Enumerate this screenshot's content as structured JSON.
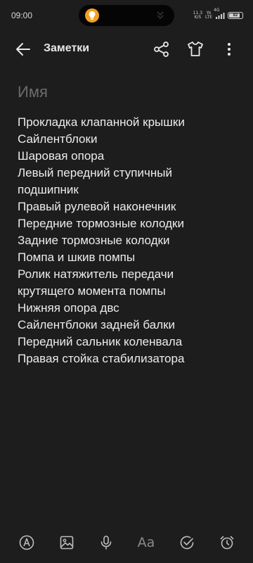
{
  "status_bar": {
    "time": "09:00",
    "network_speed_value": "11.3",
    "network_speed_unit": "K/S",
    "volte_top": "Yo",
    "volte_bottom": "LTE",
    "signal_label": "4G",
    "battery_level": "82"
  },
  "app_bar": {
    "title": "Заметки"
  },
  "note": {
    "title_placeholder": "Имя",
    "lines": [
      "Прокладка клапанной крышки",
      "Сайлентблоки",
      "Шаровая опора",
      "Левый передний ступичный",
      "подшипник",
      "Правый рулевой наконечник",
      "Передние тормозные колодки",
      "Задние тормозные колодки",
      "Помпа и шкив помпы",
      "Ролик натяжитель передачи",
      "крутящего момента помпы",
      "Нижняя опора двс",
      "Сайлентблоки задней балки",
      "Передний сальник коленвала",
      "Правая стойка стабилизатора"
    ]
  },
  "toolbar": {
    "text_format_label": "Aa"
  },
  "icons": {
    "back": "arrow-left-icon",
    "share": "share-icon",
    "theme": "tshirt-icon",
    "more": "more-vertical-icon",
    "pen": "pen-icon",
    "image": "image-icon",
    "mic": "microphone-icon",
    "checklist": "check-circle-icon",
    "alarm": "alarm-clock-icon"
  },
  "colors": {
    "background": "#1d1d1d",
    "text": "#ececec",
    "placeholder": "#6c6c6c",
    "accent_bulb": "#f0a21e"
  }
}
